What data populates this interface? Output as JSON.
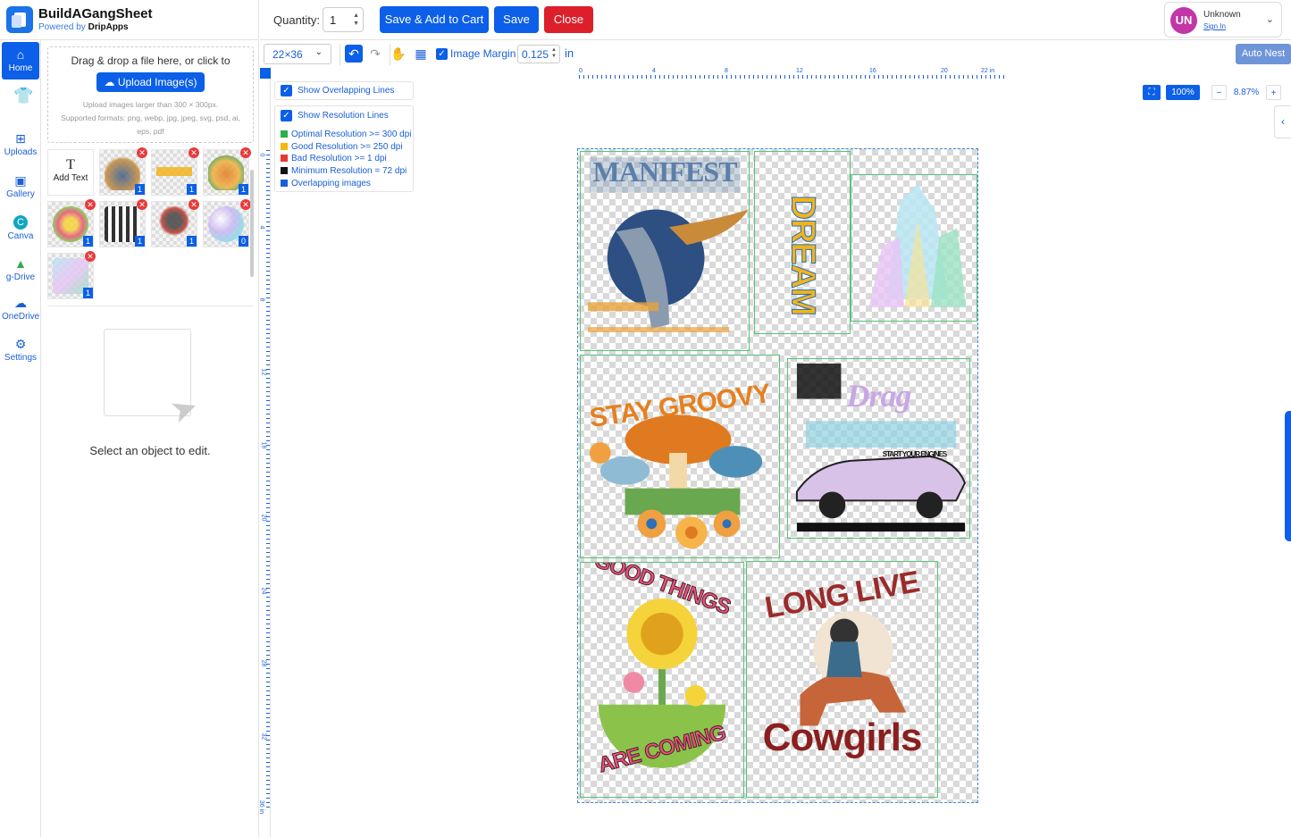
{
  "brand": {
    "title": "BuildAGangSheet",
    "sub_prefix": "Powered by ",
    "sub_name": "DripApps"
  },
  "toolbar": {
    "quantity_label": "Quantity:",
    "quantity_value": "1",
    "save_add_cart": "Save & Add to Cart",
    "save": "Save",
    "close": "Close"
  },
  "user": {
    "initials": "UN",
    "name": "Unknown",
    "sign_in": "Sign In"
  },
  "subtoolbar": {
    "sheet_size": "22×36",
    "image_margin_label": "Image Margin",
    "image_margin_value": "0.125",
    "unit": "in",
    "auto_nest": "Auto Nest"
  },
  "nav": {
    "items": [
      {
        "label": "Home",
        "icon": "home-icon"
      },
      {
        "label": "",
        "icon": "tshirt-icon"
      },
      {
        "label": "Uploads",
        "icon": "upload-icon"
      },
      {
        "label": "Gallery",
        "icon": "gallery-icon"
      },
      {
        "label": "Canva",
        "icon": "canva-icon"
      },
      {
        "label": "g-Drive",
        "icon": "gdrive-icon"
      },
      {
        "label": "OneDrive",
        "icon": "onedrive-icon"
      },
      {
        "label": "Settings",
        "icon": "gear-icon"
      }
    ]
  },
  "panel": {
    "drop_title": "Drag & drop a file here, or click to",
    "upload_button": "Upload Image(s)",
    "hint_size": "Upload images larger than 300 × 300px.",
    "hint_formats": "Supported formats: png, webp, jpg, jpeg, svg, psd, ai, eps, pdf",
    "add_text_glyph": "T",
    "add_text_label": "Add Text",
    "thumb_counts": [
      "1",
      "1",
      "1",
      "1",
      "1",
      "1",
      "0",
      "1"
    ],
    "empty_message": "Select an object to edit."
  },
  "ruler": {
    "h_labels": [
      "0",
      "4",
      "8",
      "12",
      "16",
      "20",
      "22 in"
    ],
    "v_labels": [
      "0",
      "4",
      "8",
      "12",
      "16",
      "20",
      "24",
      "28",
      "32",
      "36 in"
    ]
  },
  "legend": {
    "overlap_label": "Show Overlapping Lines",
    "resolution_label": "Show Resolution Lines",
    "rows": [
      {
        "label": "Optimal Resolution >= 300 dpi",
        "color": "#2ab04a"
      },
      {
        "label": "Good Resolution >= 250 dpi",
        "color": "#f2b90f"
      },
      {
        "label": "Bad Resolution >= 1 dpi",
        "color": "#e53935"
      },
      {
        "label": "Minimum Resolution = 72 dpi",
        "color": "#111111"
      },
      {
        "label": "Overlapping images",
        "color": "#1a5fd6"
      }
    ]
  },
  "zoom": {
    "fit": "100%",
    "level": "8.87%"
  },
  "designs": {
    "manifest": "MANIFEST",
    "dream": "DREAM",
    "stay_groovy": "STAY GROOVY",
    "drag_race": "Drag",
    "start_engines": "START YOUR ENGINES",
    "good_things": "GOOD THINGS",
    "are_coming": "ARE COMING",
    "long_live": "LONG LIVE",
    "cowgirls": "Cowgirls"
  }
}
